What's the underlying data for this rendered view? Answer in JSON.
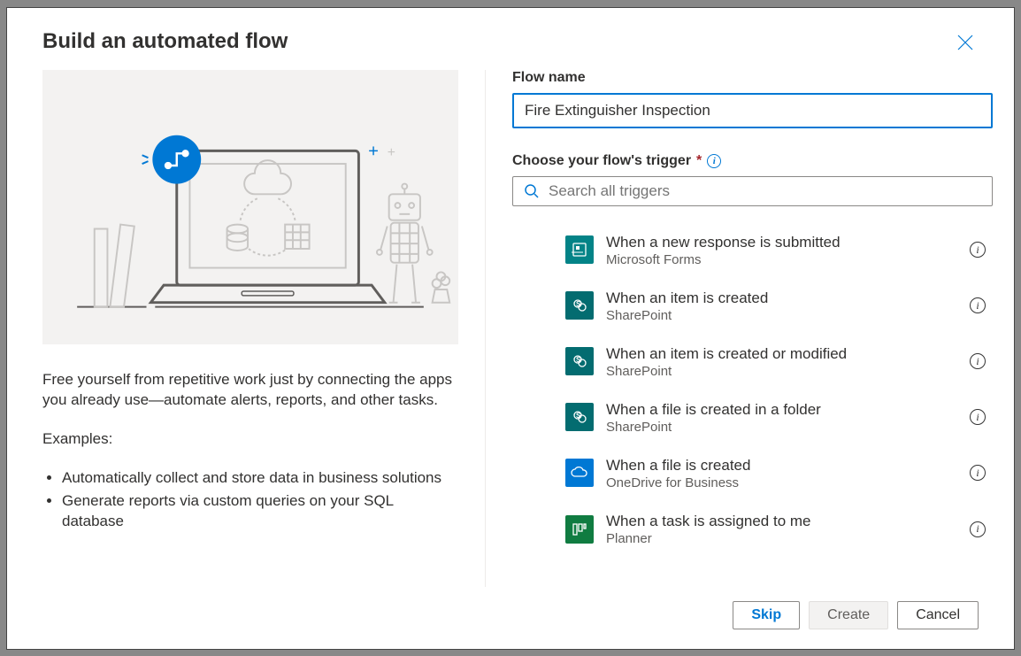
{
  "header": {
    "title": "Build an automated flow"
  },
  "left": {
    "description": "Free yourself from repetitive work just by connecting the apps you already use—automate alerts, reports, and other tasks.",
    "examples_label": "Examples:",
    "examples": [
      "Automatically collect and store data in business solutions",
      "Generate reports via custom queries on your SQL database"
    ]
  },
  "form": {
    "flow_name_label": "Flow name",
    "flow_name_value": "Fire Extinguisher Inspection",
    "trigger_label": "Choose your flow's trigger",
    "search_placeholder": "Search all triggers"
  },
  "triggers": [
    {
      "title": "When a new response is submitted",
      "sub": "Microsoft Forms",
      "color": "#038387",
      "icon": "forms"
    },
    {
      "title": "When an item is created",
      "sub": "SharePoint",
      "color": "#036c70",
      "icon": "sharepoint"
    },
    {
      "title": "When an item is created or modified",
      "sub": "SharePoint",
      "color": "#036c70",
      "icon": "sharepoint"
    },
    {
      "title": "When a file is created in a folder",
      "sub": "SharePoint",
      "color": "#036c70",
      "icon": "sharepoint"
    },
    {
      "title": "When a file is created",
      "sub": "OneDrive for Business",
      "color": "#0078d4",
      "icon": "onedrive"
    },
    {
      "title": "When a task is assigned to me",
      "sub": "Planner",
      "color": "#107c41",
      "icon": "planner"
    }
  ],
  "footer": {
    "skip": "Skip",
    "create": "Create",
    "cancel": "Cancel"
  }
}
